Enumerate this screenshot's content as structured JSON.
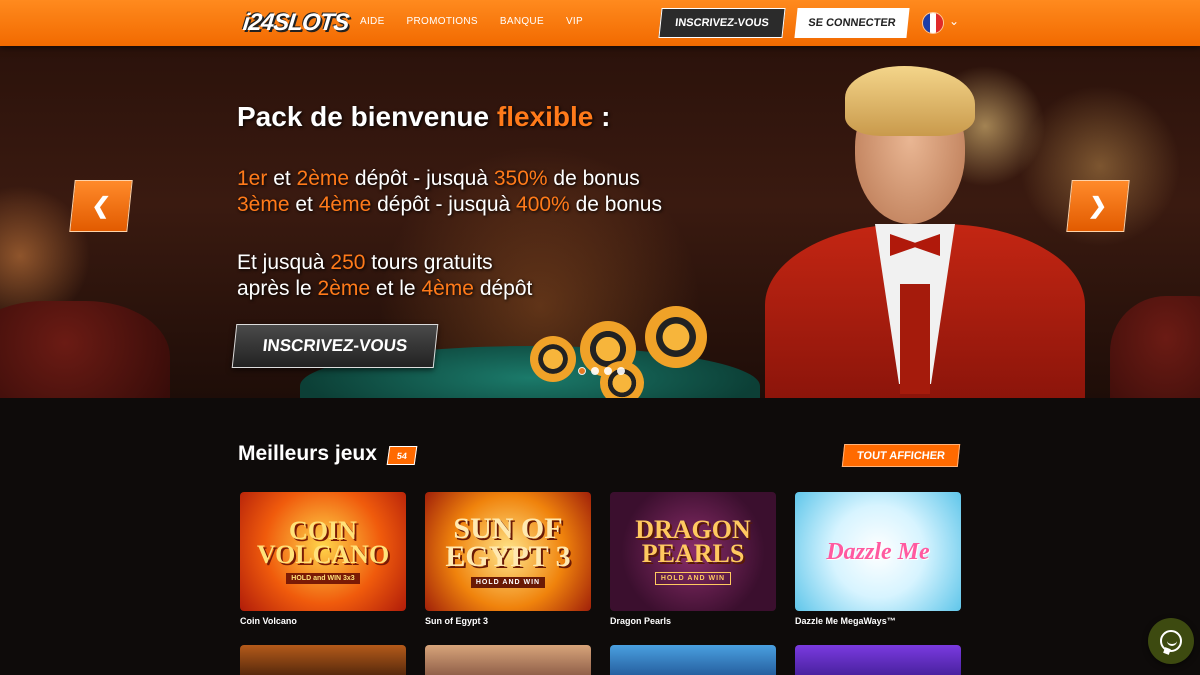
{
  "header": {
    "logo": "i24SLOTS",
    "nav": [
      "AIDE",
      "PROMOTIONS",
      "BANQUE",
      "VIP"
    ],
    "signup_label": "INSCRIVEZ-VOUS",
    "login_label": "SE CONNECTER",
    "language_icon": "france-flag-icon"
  },
  "hero": {
    "title_pre": "Pack de bienvenue ",
    "title_highlight": "flexible",
    "title_post": " :",
    "line1": {
      "a": "1er",
      "b": " et ",
      "c": "2ème",
      "d": " dépôt - jusquà ",
      "e": "350%",
      "f": " de bonus"
    },
    "line2": {
      "a": "3ème",
      "b": " et ",
      "c": "4ème",
      "d": " dépôt - jusquà ",
      "e": "400%",
      "f": " de bonus"
    },
    "line3": {
      "a": "Et jusquà ",
      "b": "250",
      "c": " tours gratuits"
    },
    "line4": {
      "a": "après le ",
      "b": "2ème",
      "c": " et le ",
      "d": "4ème",
      "e": " dépôt"
    },
    "cta_label": "INSCRIVEZ-VOUS",
    "slides_count": 4,
    "active_slide": 1
  },
  "games_section": {
    "title": "Meilleurs jeux",
    "count": "54",
    "show_all_label": "TOUT AFFICHER",
    "games": [
      {
        "name": "Coin Volcano",
        "art_title": "COIN\nVOLCANO",
        "art_sub": "HOLD and WIN 3x3"
      },
      {
        "name": "Sun of Egypt 3",
        "art_title": "SUN OF\nEGYPT 3",
        "art_sub": "HOLD AND WIN"
      },
      {
        "name": "Dragon Pearls",
        "art_title": "DRAGON\nPEARLS",
        "art_sub": "HOLD AND WIN"
      },
      {
        "name": "Dazzle Me MegaWays™",
        "art_title": "Dazzle Me",
        "art_sub": ""
      }
    ]
  },
  "colors": {
    "accent": "#ff6a00",
    "header": "#f26a00",
    "background": "#0e0b0a"
  }
}
